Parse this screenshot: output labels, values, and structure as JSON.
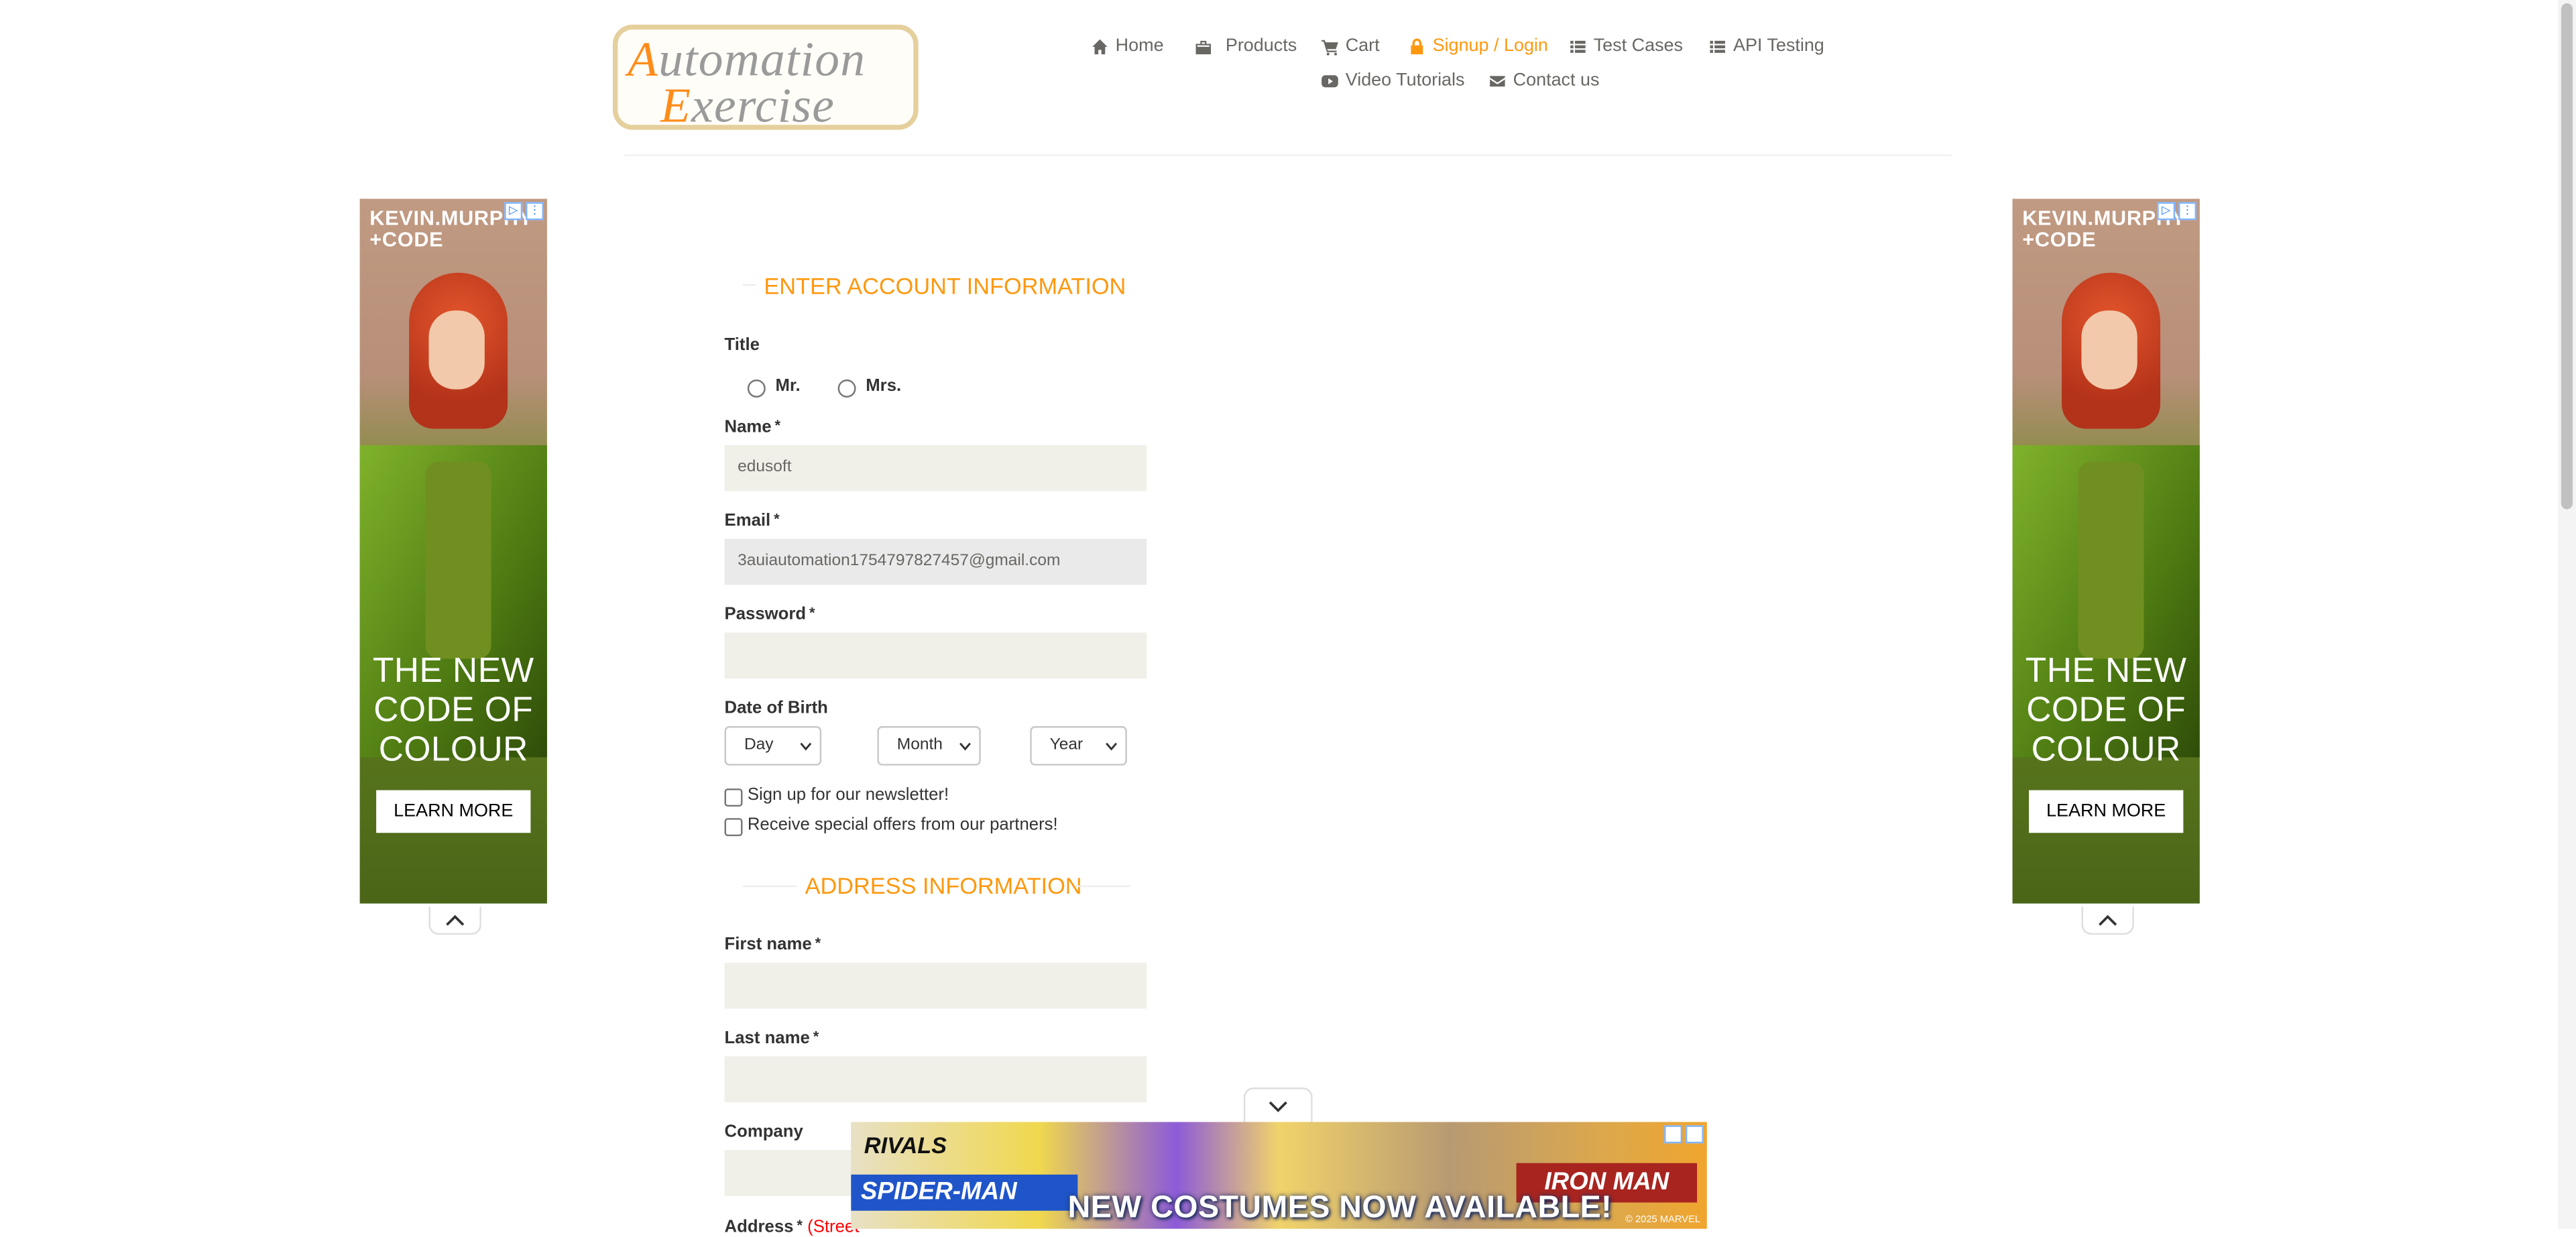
{
  "logo": {
    "line1_cap": "A",
    "line1_rest": "utomation",
    "line2_cap": "E",
    "line2_rest": "xercise"
  },
  "nav": {
    "home": "Home",
    "products": "Products",
    "cart": "Cart",
    "signup_login": "Signup / Login",
    "test_cases": "Test Cases",
    "api_testing": "API Testing",
    "video_tutorials": "Video Tutorials",
    "contact_us": "Contact us"
  },
  "side_ad": {
    "brand_line1": "KEVIN.MURPHY",
    "brand_line2": "+CODE",
    "tagline_1": "THE NEW",
    "tagline_2": "CODE OF",
    "tagline_3": "COLOUR",
    "cta": "LEARN MORE"
  },
  "form": {
    "account_heading": "ENTER ACCOUNT INFORMATION",
    "title_label": "Title",
    "title_options": [
      "Mr.",
      "Mrs."
    ],
    "name_label": "Name",
    "name_value": "edusoft",
    "email_label": "Email",
    "email_value": "3auiautomation1754797827457@gmail.com",
    "password_label": "Password",
    "password_value": "",
    "required_mark": "*",
    "dob_label": "Date of Birth",
    "dob_day": "Day",
    "dob_month": "Month",
    "dob_year": "Year",
    "newsletter_label": "Sign up for our newsletter!",
    "offers_label": "Receive special offers from our partners!",
    "address_heading": "ADDRESS INFORMATION",
    "first_name_label": "First name",
    "last_name_label": "Last name",
    "company_label": "Company",
    "address_label": "Address",
    "address_hint": "(Street"
  },
  "bottom_ad": {
    "game": "RIVALS",
    "hero_left": "SPIDER-MAN",
    "hero_right": "IRON MAN",
    "promo": "NEW COSTUMES NOW AVAILABLE!",
    "copyright": "© 2025 MARVEL"
  },
  "colors": {
    "accent": "#fe980f",
    "field_bg": "#f0f0e9",
    "nav_text": "#696763"
  }
}
